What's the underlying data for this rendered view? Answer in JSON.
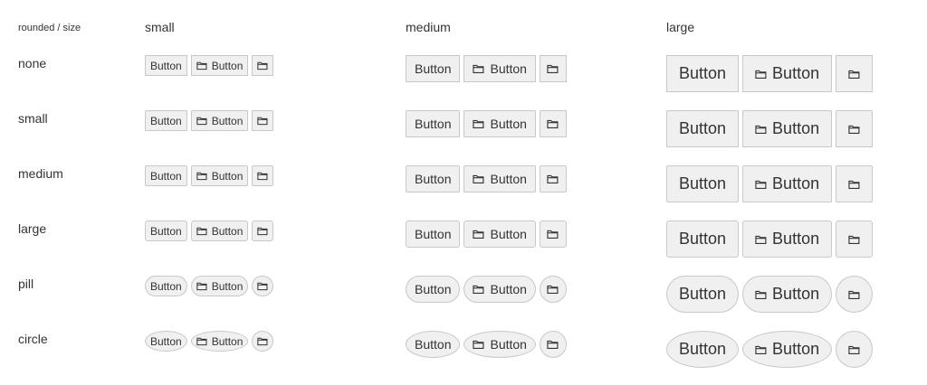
{
  "headers": {
    "corner": "rounded / size",
    "small": "small",
    "medium": "medium",
    "large": "large"
  },
  "rows": [
    {
      "label": "none"
    },
    {
      "label": "small"
    },
    {
      "label": "medium"
    },
    {
      "label": "large"
    },
    {
      "label": "pill"
    },
    {
      "label": "circle"
    }
  ],
  "button_label": "Button",
  "icon": "folder-icon",
  "colors": {
    "button_bg": "#f0f0f0",
    "button_border": "#c8c8c8",
    "text": "#333333"
  }
}
